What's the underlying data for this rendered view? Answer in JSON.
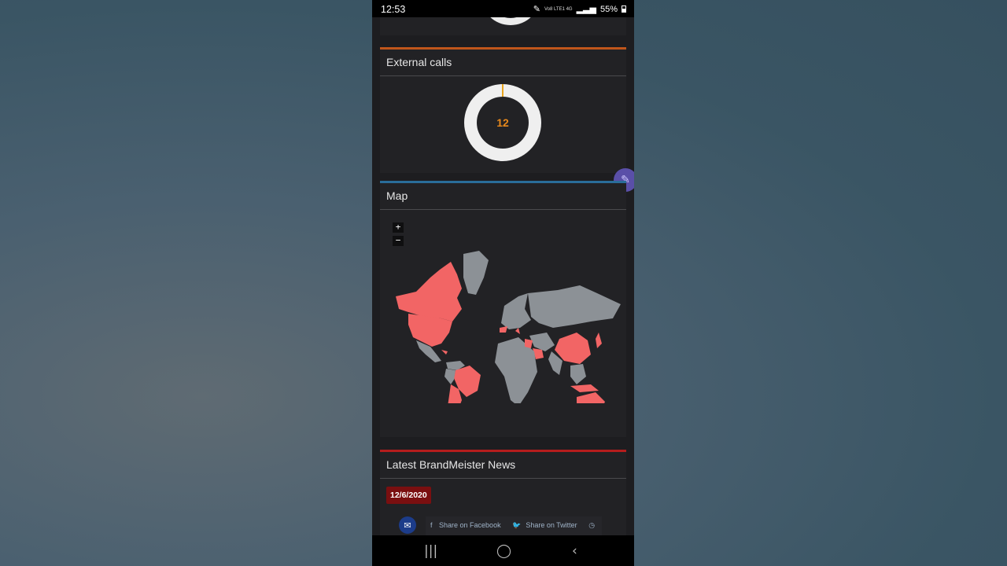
{
  "status_bar": {
    "time": "12:53",
    "network": "Vo8 LTE1 4G",
    "battery": "55%"
  },
  "cards": {
    "external_calls": {
      "title": "External calls",
      "value": "12"
    },
    "map": {
      "title": "Map",
      "zoom_in": "+",
      "zoom_out": "−"
    },
    "news": {
      "title": "Latest BrandMeister News",
      "date": "12/6/2020",
      "share_facebook": "Share on Facebook",
      "share_twitter": "Share on Twitter"
    }
  },
  "colors": {
    "highlight_countries": "#f26565",
    "other_countries": "#8c9196",
    "accent_orange": "#c0561b",
    "accent_blue": "#2a6d9a",
    "accent_red": "#b51d1d"
  },
  "icons": {
    "edit": "pencil-icon",
    "mail": "envelope-icon",
    "facebook": "facebook-icon",
    "twitter": "twitter-icon",
    "clock": "clock-icon"
  }
}
